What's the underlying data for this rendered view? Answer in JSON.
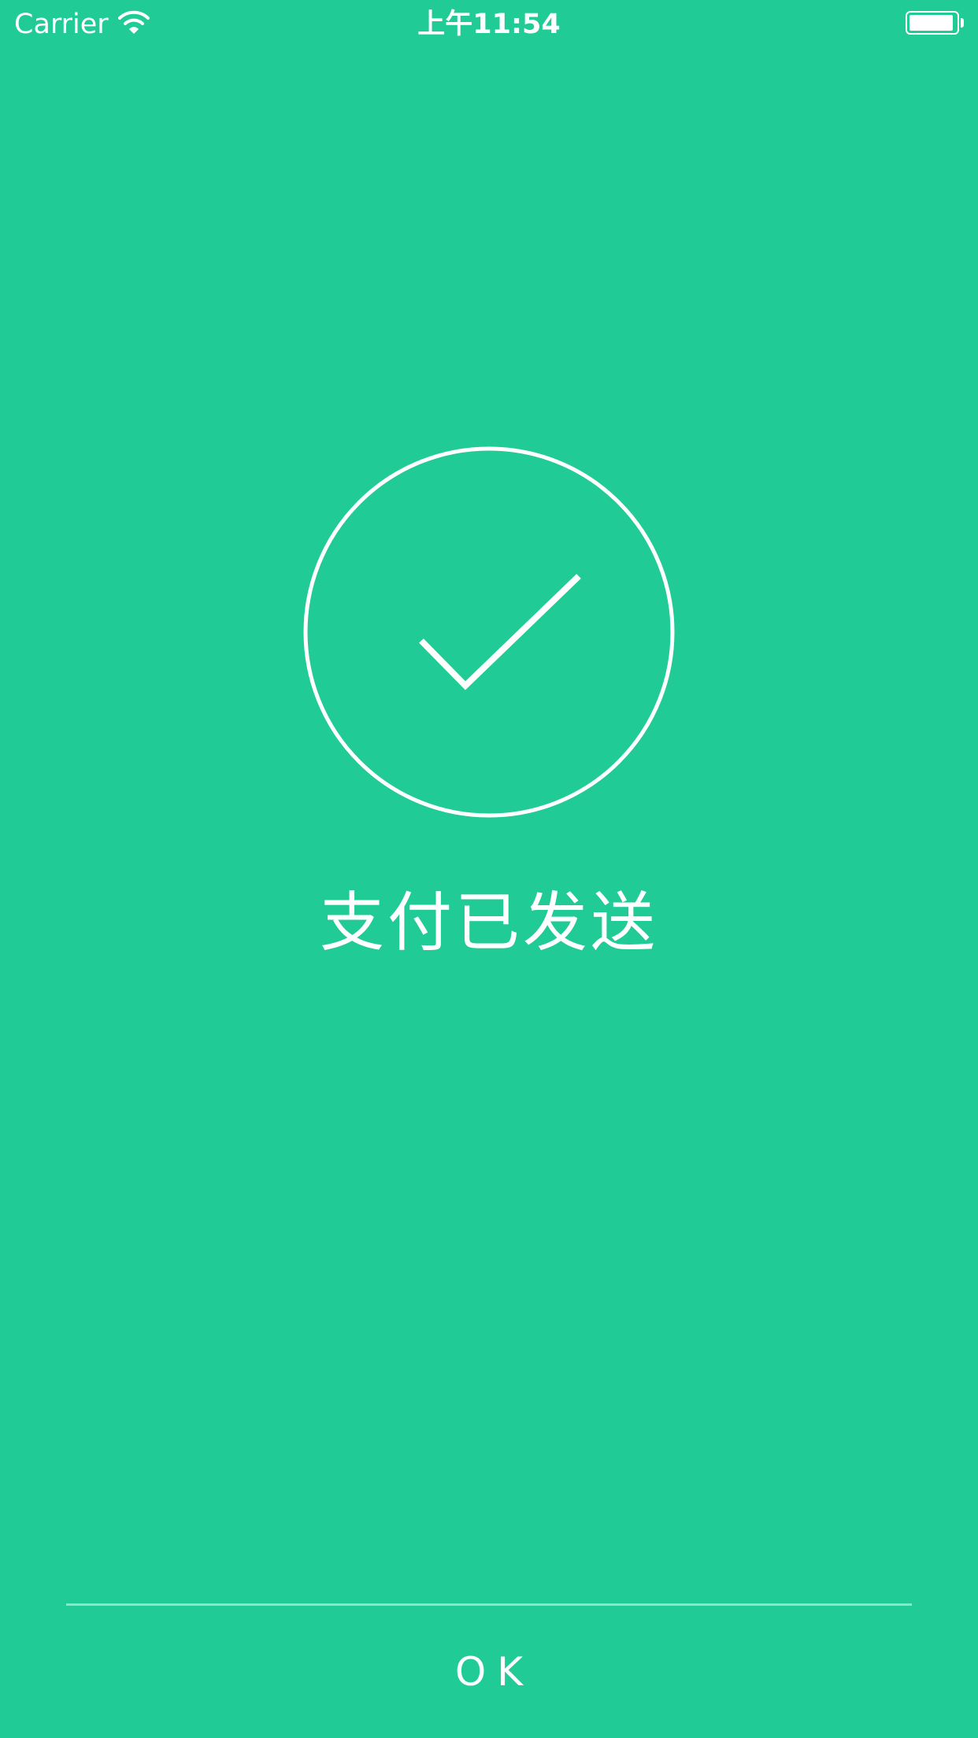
{
  "status_bar": {
    "carrier": "Carrier",
    "time": "上午11:54",
    "battery_level": 0.95,
    "wifi_icon": "wifi-icon",
    "battery_icon": "battery-icon"
  },
  "main": {
    "icon": "checkmark-circle-icon",
    "message": "支付已发送"
  },
  "footer": {
    "ok_label": "OK"
  },
  "colors": {
    "background": "#20CB95",
    "foreground": "#FFFFFF",
    "divider": "#8EE4C9"
  }
}
